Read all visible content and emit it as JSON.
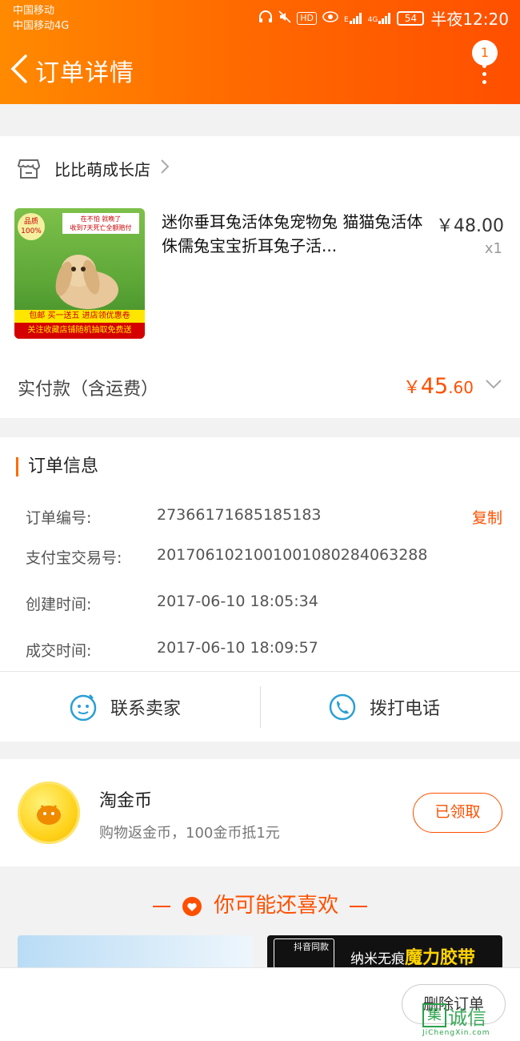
{
  "status_bar": {
    "carrier1": "中国移动",
    "carrier2": "中国移动4G",
    "hd": "HD",
    "net1": "E",
    "net2": "4G",
    "battery": "54",
    "time": "半夜12:20"
  },
  "header": {
    "title": "订单详情",
    "badge": "1"
  },
  "shop": {
    "name": "比比萌成长店"
  },
  "product": {
    "title": "迷你垂耳兔活体兔宠物兔 猫猫兔活体侏儒兔宝宝折耳兔子活...",
    "price": "￥48.00",
    "qty": "x1",
    "image_text": {
      "quality": "品质100%",
      "top_line1": "在不怕 就晚了",
      "top_line2": "收到7天死亡全额赔付",
      "promo1": "包邮 买一送五 进店领优惠卷",
      "promo2": "关注收藏店铺随机抽取免费送"
    }
  },
  "payment": {
    "label": "实付款（含运费）",
    "currency": "￥",
    "amount_int": "45",
    "amount_dec": ".60"
  },
  "order_info": {
    "title": "订单信息",
    "rows": [
      {
        "label": "订单编号:",
        "value": "27366171685185183"
      },
      {
        "label": "支付宝交易号:",
        "value": "2017061021001001080284063288"
      },
      {
        "label": "创建时间:",
        "value": "2017-06-10 18:05:34"
      },
      {
        "label": "成交时间:",
        "value": "2017-06-10 18:09:57"
      }
    ],
    "copy_label": "复制"
  },
  "actions": {
    "contact_seller": "联系卖家",
    "call_phone": "拨打电话"
  },
  "coin": {
    "title": "淘金币",
    "subtitle": "购物返金币，100金币抵1元",
    "button": "已领取"
  },
  "recommend": {
    "title": "你可能还喜欢",
    "tile2_box": "抖音同款",
    "tile2_text_a": "纳米无痕",
    "tile2_text_b": "魔力胶带"
  },
  "bottom": {
    "delete_label": "删除订单"
  },
  "watermark": {
    "box": "集",
    "text": "诚信",
    "url": "JiChengXin.com"
  },
  "colors": {
    "accent": "#ff5000",
    "header_start": "#ff8a00",
    "header_end": "#ff4f00"
  }
}
